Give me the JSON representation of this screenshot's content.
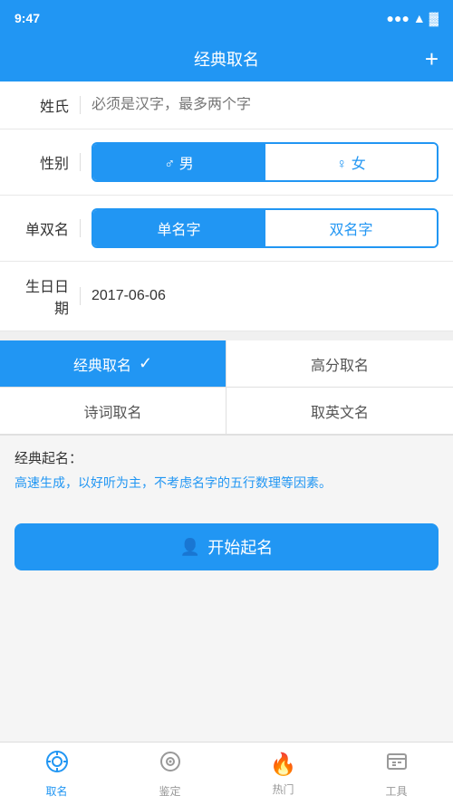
{
  "statusBar": {
    "time": "9:47"
  },
  "header": {
    "title": "经典取名",
    "plusLabel": "+"
  },
  "form": {
    "surnameLabel": "姓氏",
    "surnamePlaceholder": "必须是汉字，最多两个字",
    "genderLabel": "性别",
    "genderMale": "♂ 男",
    "genderFemale": "♀ 女",
    "nameTypeLabel": "单双名",
    "nameSingle": "单名字",
    "nameDouble": "双名字",
    "birthdayLabel": "生日日期",
    "birthdayValue": "2017-06-06"
  },
  "nameTabs": [
    {
      "id": "classic",
      "label": "经典取名",
      "active": true
    },
    {
      "id": "highscore",
      "label": "高分取名",
      "active": false
    },
    {
      "id": "poetry",
      "label": "诗词取名",
      "active": false
    },
    {
      "id": "english",
      "label": "取英文名",
      "active": false
    }
  ],
  "description": {
    "title": "经典起名：",
    "body": "高速生成，以好听为主，不考虑名字的五行数理等因素。"
  },
  "startButton": {
    "icon": "👤",
    "label": "开始起名"
  },
  "tabBar": {
    "items": [
      {
        "id": "naming",
        "icon": "⚙",
        "label": "取名",
        "active": true
      },
      {
        "id": "appraise",
        "icon": "◎",
        "label": "鉴定",
        "active": false
      },
      {
        "id": "hot",
        "icon": "🔥",
        "label": "热门",
        "active": false
      },
      {
        "id": "tools",
        "icon": "🧰",
        "label": "工具",
        "active": false
      }
    ]
  }
}
